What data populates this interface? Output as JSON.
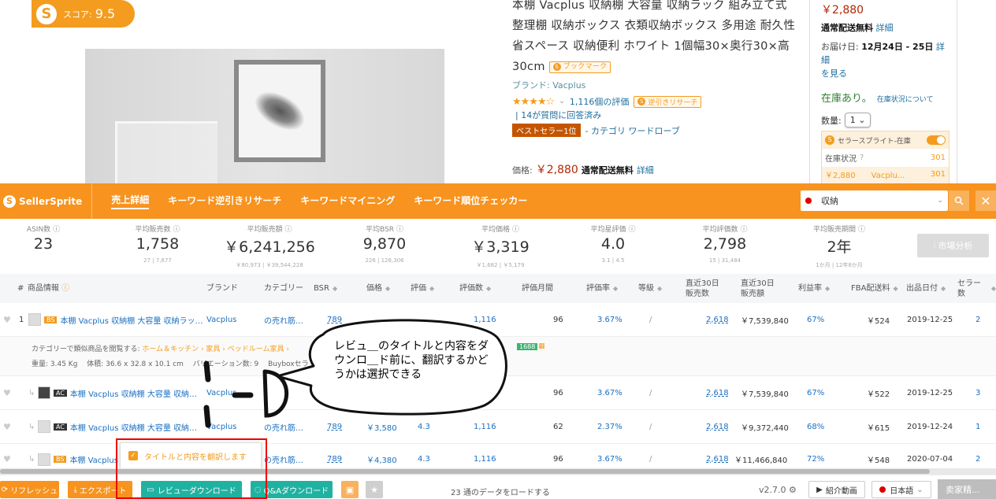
{
  "score": {
    "label": "スコア:",
    "value": "9.5"
  },
  "product": {
    "title": "本棚 Vacplus 収納棚 大容量 収納ラック 組み立て式 整理棚 収納ボックス 衣類収納ボックス 多用途 耐久性 省スペース 収納便利 ホワイト 1個幅30×奥行30×高30cm",
    "bookmark_label": "ブックマーク",
    "brand": "ブランド: Vacplus",
    "stars": "★★★★☆",
    "rating_count": "1,116個の評価",
    "review_search_label": "逆引きリサーチ",
    "qa": "14が質問に回答済み",
    "bestseller_badge": "ベストセラー1位",
    "category": "- カテゴリ ワードローブ",
    "price_label": "価格:",
    "price": "￥2,880",
    "shipping": "通常配送無料",
    "detail_link": "詳細"
  },
  "buybox": {
    "price": "￥2,880",
    "shipping": "通常配送無料",
    "detail": "詳細",
    "date_prefix": "お届け日:",
    "date": "12月24日 - 25日",
    "date_detail": "詳細",
    "see": "を見る",
    "stock": "在庫あり。",
    "stock_info": "在庫状況について",
    "qty_label": "数量:",
    "qty_value": "1",
    "panel_title": "セラースプライト-在庫",
    "panel_row_label": "在庫状況",
    "panel_row_value": "301",
    "panel_row2_label": "￥2,880　　Vacplu...",
    "panel_row2_value": "301"
  },
  "seller_sprite": {
    "logo": "SellerSprite",
    "tabs": [
      "売上詳細",
      "キーワード逆引きリサーチ",
      "キーワードマイニング",
      "キーワード順位チェッカー"
    ],
    "search_value": "収納",
    "stats": [
      {
        "title": "ASIN数",
        "value": "23",
        "sub": ""
      },
      {
        "title": "平均販売数",
        "value": "1,758",
        "sub": "27 | 7,677"
      },
      {
        "title": "平均販売額",
        "value": "￥6,241,256",
        "sub": "￥80,973 | ￥39,544,228"
      },
      {
        "title": "平均BSR",
        "value": "9,870",
        "sub": "226 | 128,306"
      },
      {
        "title": "平均価格",
        "value": "￥3,319",
        "sub": "￥1,682 | ￥5,179"
      },
      {
        "title": "平均星評価",
        "value": "4.0",
        "sub": "3.1 | 4.5"
      },
      {
        "title": "平均評価数",
        "value": "2,798",
        "sub": "15 | 31,484"
      },
      {
        "title": "平均販売期間",
        "value": "2年",
        "sub": "1か月 | 12年8か月"
      }
    ],
    "market_button": "市場分析"
  },
  "table": {
    "headers": {
      "num": "#",
      "product": "商品情報",
      "brand": "ブランド",
      "category": "カテゴリー",
      "bsr": "BSR",
      "price": "価格",
      "rating": "評価",
      "reviews": "評価数",
      "review_month": "評価月間",
      "review_rate": "評価率",
      "level": "等級",
      "sales30_a": "直近30日",
      "sales30_b": "販売数",
      "rev30_a": "直近30日",
      "rev30_b": "販売額",
      "profit": "利益率",
      "fba": "FBA配送料",
      "date": "出品日付",
      "sellers": "セラー数"
    },
    "rows": [
      {
        "num": "1",
        "tag": "BS",
        "title": "本棚 Vacplus 収納棚 大容量 収納ラッ…",
        "brand": "Vacplus",
        "category": "の売れ筋…",
        "bsr": "789",
        "price": "",
        "rating": "",
        "reviews": "1,116",
        "month": "96",
        "rate": "3.67%",
        "level": "/",
        "sales": "2,618",
        "revenue": "￥7,539,840",
        "profit": "67%",
        "fba": "￥524",
        "date": "2019-12-25",
        "sellers": "2"
      },
      {
        "num": "",
        "tag": "AC",
        "title": "本棚 Vacplus 収納棚 大容量 収納…",
        "brand": "Vacplus",
        "category": "",
        "bsr": "",
        "price": "",
        "rating": "",
        "reviews": "",
        "month": "96",
        "rate": "3.67%",
        "level": "/",
        "sales": "2,618",
        "revenue": "￥7,539,840",
        "profit": "67%",
        "fba": "￥522",
        "date": "2019-12-25",
        "sellers": "3"
      },
      {
        "num": "",
        "tag": "AC",
        "title": "本棚 Vacplus 収納棚 大容量 収納…",
        "brand": "Vacplus",
        "category": "の売れ筋…",
        "bsr": "789",
        "price": "￥3,580",
        "rating": "4.3",
        "reviews": "1,116",
        "month": "62",
        "rate": "2.37%",
        "level": "/",
        "sales": "2,618",
        "revenue": "￥9,372,440",
        "profit": "68%",
        "fba": "￥615",
        "date": "2019-12-24",
        "sellers": "1"
      },
      {
        "num": "",
        "tag": "BS",
        "title": "本棚 Vacplus",
        "brand": "",
        "category": "の売れ筋…",
        "bsr": "789",
        "price": "￥4,380",
        "rating": "4.3",
        "reviews": "1,116",
        "month": "96",
        "rate": "3.67%",
        "level": "/",
        "sales": "2,618",
        "revenue": "￥11,466,840",
        "profit": "72%",
        "fba": "￥548",
        "date": "2020-07-04",
        "sellers": "2"
      }
    ],
    "expand": {
      "line1_prefix": "カテゴリーで類似商品を閲覧する:",
      "line1_links": "ホーム＆キッチン › 家具 › ベッドルーム家具 ›",
      "badge": "1688",
      "line2": "重量: 3.45 Kg　 体積: 36.6 x 32.8 x 10.1 cm　 バリエーション数: 9　 Buyboxセラ"
    }
  },
  "annotation": {
    "bubble": "レビュ＿のタイトルと内容をダウンロ＿ド前に、翻訳するかどうかは選択できる",
    "popup": "タイトルと内容を翻訳します"
  },
  "toolbar": {
    "refresh": "リフレッシュ",
    "export": "エクスポート",
    "review_download": "レビューダウンロード",
    "qa_download": "Q&Aダウンロード",
    "load_text": "23 通のデータをロードする",
    "version": "v2.7.0",
    "intro_video": "紹介動画",
    "language": "日本語",
    "right_button": "卖家精..."
  }
}
